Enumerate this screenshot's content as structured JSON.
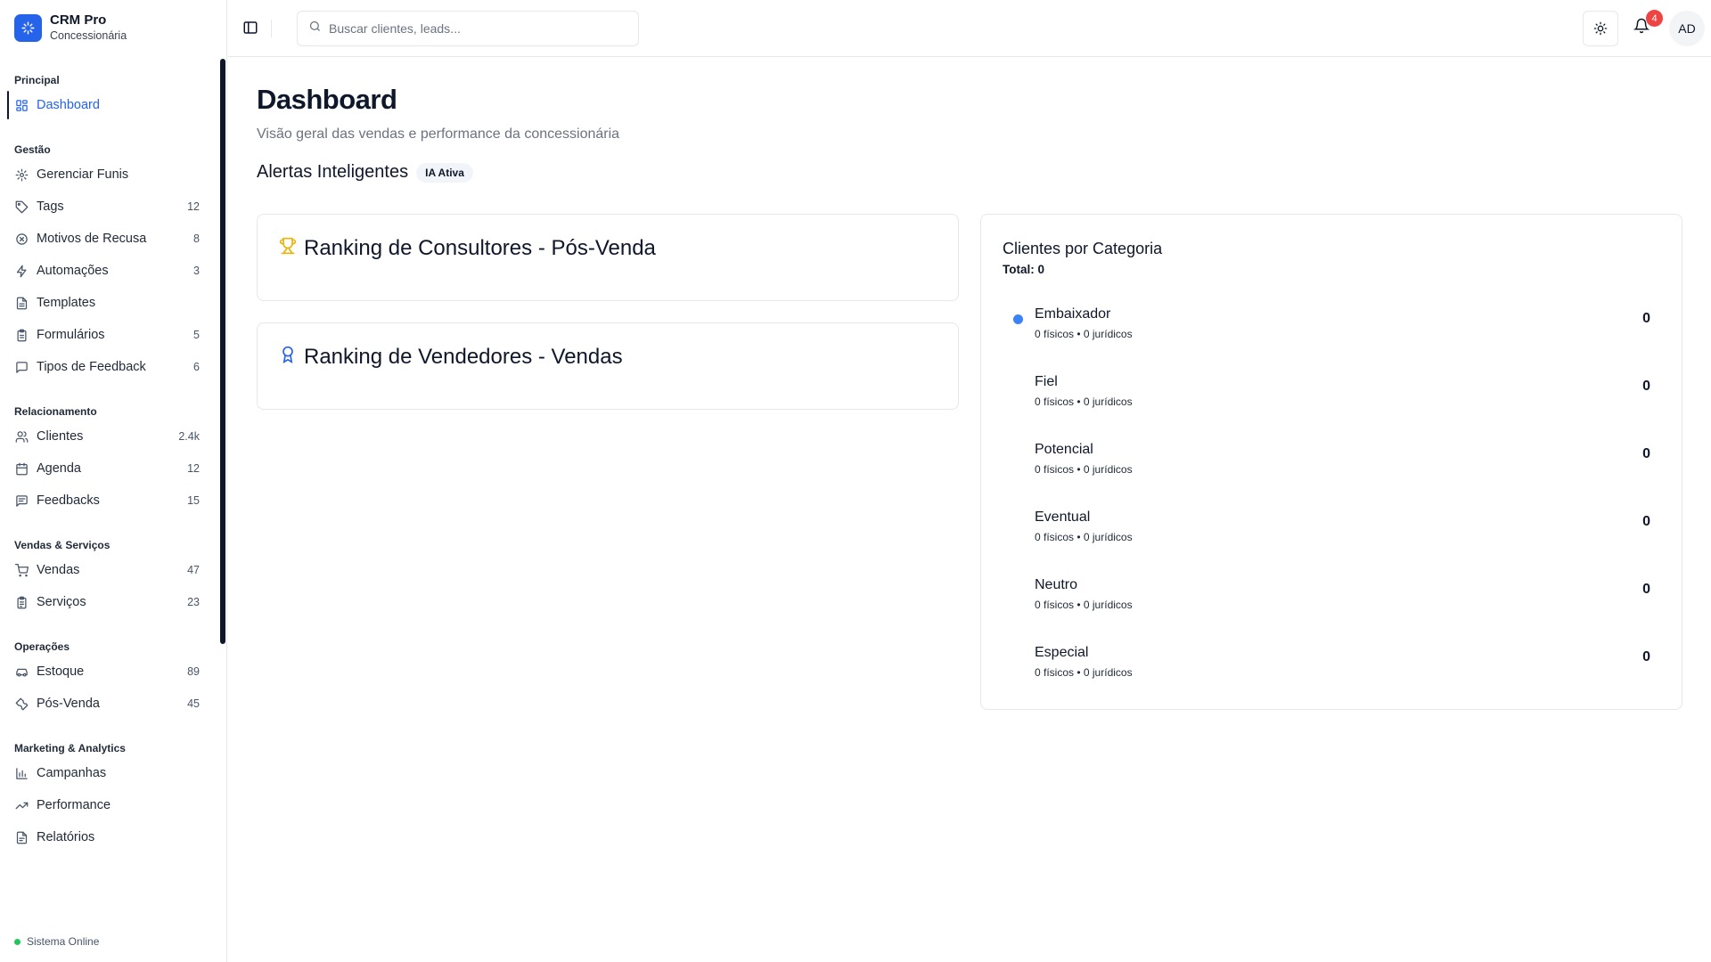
{
  "brand": {
    "name": "CRM Pro",
    "subtitle": "Concessionária"
  },
  "sidebar": {
    "groups": [
      {
        "title": "Principal",
        "items": [
          {
            "label": "Dashboard",
            "count": "",
            "icon": "layout-grid-icon",
            "active": true
          }
        ]
      },
      {
        "title": "Gestão",
        "items": [
          {
            "label": "Gerenciar Funis",
            "count": "",
            "icon": "gear-icon"
          },
          {
            "label": "Tags",
            "count": "12",
            "icon": "tag-icon"
          },
          {
            "label": "Motivos de Recusa",
            "count": "8",
            "icon": "x-circle-icon"
          },
          {
            "label": "Automações",
            "count": "3",
            "icon": "lightning-icon"
          },
          {
            "label": "Templates",
            "count": "",
            "icon": "file-text-icon"
          },
          {
            "label": "Formulários",
            "count": "5",
            "icon": "clipboard-icon"
          },
          {
            "label": "Tipos de Feedback",
            "count": "6",
            "icon": "message-square-icon"
          }
        ]
      },
      {
        "title": "Relacionamento",
        "items": [
          {
            "label": "Clientes",
            "count": "2.4k",
            "icon": "users-icon"
          },
          {
            "label": "Agenda",
            "count": "12",
            "icon": "calendar-icon"
          },
          {
            "label": "Feedbacks",
            "count": "15",
            "icon": "message-lines-icon"
          }
        ]
      },
      {
        "title": "Vendas & Serviços",
        "items": [
          {
            "label": "Vendas",
            "count": "47",
            "icon": "cart-icon"
          },
          {
            "label": "Serviços",
            "count": "23",
            "icon": "clipboard-list-icon"
          }
        ]
      },
      {
        "title": "Operações",
        "items": [
          {
            "label": "Estoque",
            "count": "89",
            "icon": "car-icon"
          },
          {
            "label": "Pós-Venda",
            "count": "45",
            "icon": "wrench-icon"
          }
        ]
      },
      {
        "title": "Marketing & Analytics",
        "items": [
          {
            "label": "Campanhas",
            "count": "",
            "icon": "bar-chart-icon"
          },
          {
            "label": "Performance",
            "count": "",
            "icon": "trending-up-icon"
          },
          {
            "label": "Relatórios",
            "count": "",
            "icon": "file-report-icon"
          }
        ]
      }
    ],
    "status": "Sistema Online"
  },
  "topbar": {
    "search_placeholder": "Buscar clientes, leads...",
    "notifications_count": "4",
    "avatar_initials": "AD"
  },
  "main": {
    "title": "Dashboard",
    "subtitle": "Visão geral das vendas e performance da concessionária",
    "alerts_title": "Alertas Inteligentes",
    "alerts_badge": "IA Ativa",
    "ranking_consultores": "Ranking de Consultores - Pós-Venda",
    "ranking_vendedores": "Ranking de Vendedores - Vendas",
    "categories": {
      "title": "Clientes por Categoria",
      "total": "Total: 0",
      "items": [
        {
          "name": "Embaixador",
          "meta": "0 físicos • 0 jurídicos",
          "value": "0",
          "dot": true
        },
        {
          "name": "Fiel",
          "meta": "0 físicos • 0 jurídicos",
          "value": "0",
          "dot": false
        },
        {
          "name": "Potencial",
          "meta": "0 físicos • 0 jurídicos",
          "value": "0",
          "dot": false
        },
        {
          "name": "Eventual",
          "meta": "0 físicos • 0 jurídicos",
          "value": "0",
          "dot": false
        },
        {
          "name": "Neutro",
          "meta": "0 físicos • 0 jurídicos",
          "value": "0",
          "dot": false
        },
        {
          "name": "Especial",
          "meta": "0 físicos • 0 jurídicos",
          "value": "0",
          "dot": false
        }
      ]
    }
  },
  "colors": {
    "accent": "#2563eb",
    "online": "#22c55e",
    "badge": "#ef4444",
    "trophy": "#eab308",
    "category_dot": "#3b82f6"
  }
}
